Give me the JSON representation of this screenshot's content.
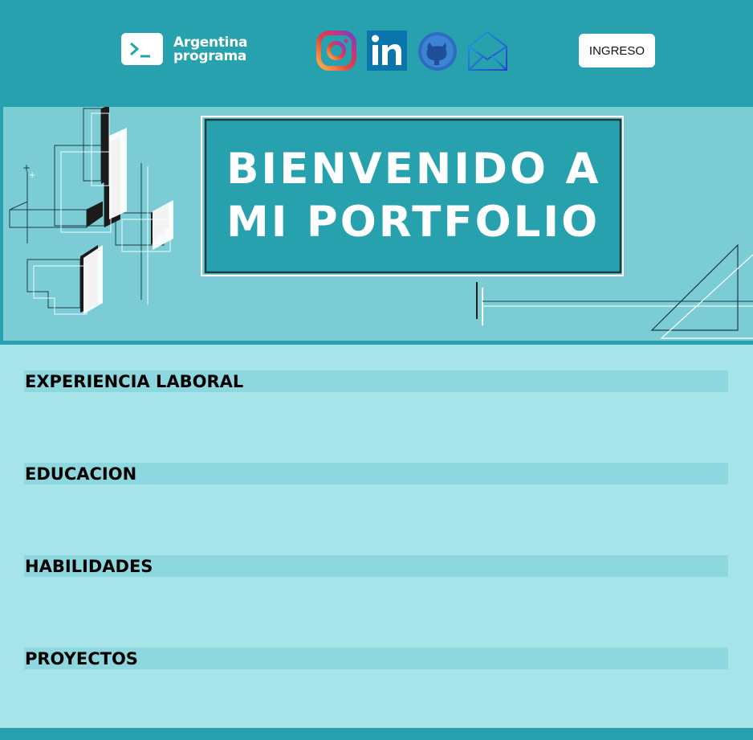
{
  "header": {
    "logo_line1": "Argentina",
    "logo_line2": "programa",
    "social_icons": [
      "instagram-icon",
      "linkedin-icon",
      "github-icon",
      "email-icon"
    ],
    "login_label": "INGRESO"
  },
  "hero": {
    "line1": "BIENVENIDO A",
    "line2": "MI PORTFOLIO"
  },
  "sections": [
    {
      "title": "EXPERIENCIA LABORAL"
    },
    {
      "title": "EDUCACION"
    },
    {
      "title": "HABILIDADES"
    },
    {
      "title": "PROYECTOS"
    }
  ],
  "colors": {
    "header_bg": "#27a1ad",
    "hero_bg": "#7bccd5",
    "page_bg": "#a7e4ea",
    "section_bar": "#8dd7df"
  }
}
